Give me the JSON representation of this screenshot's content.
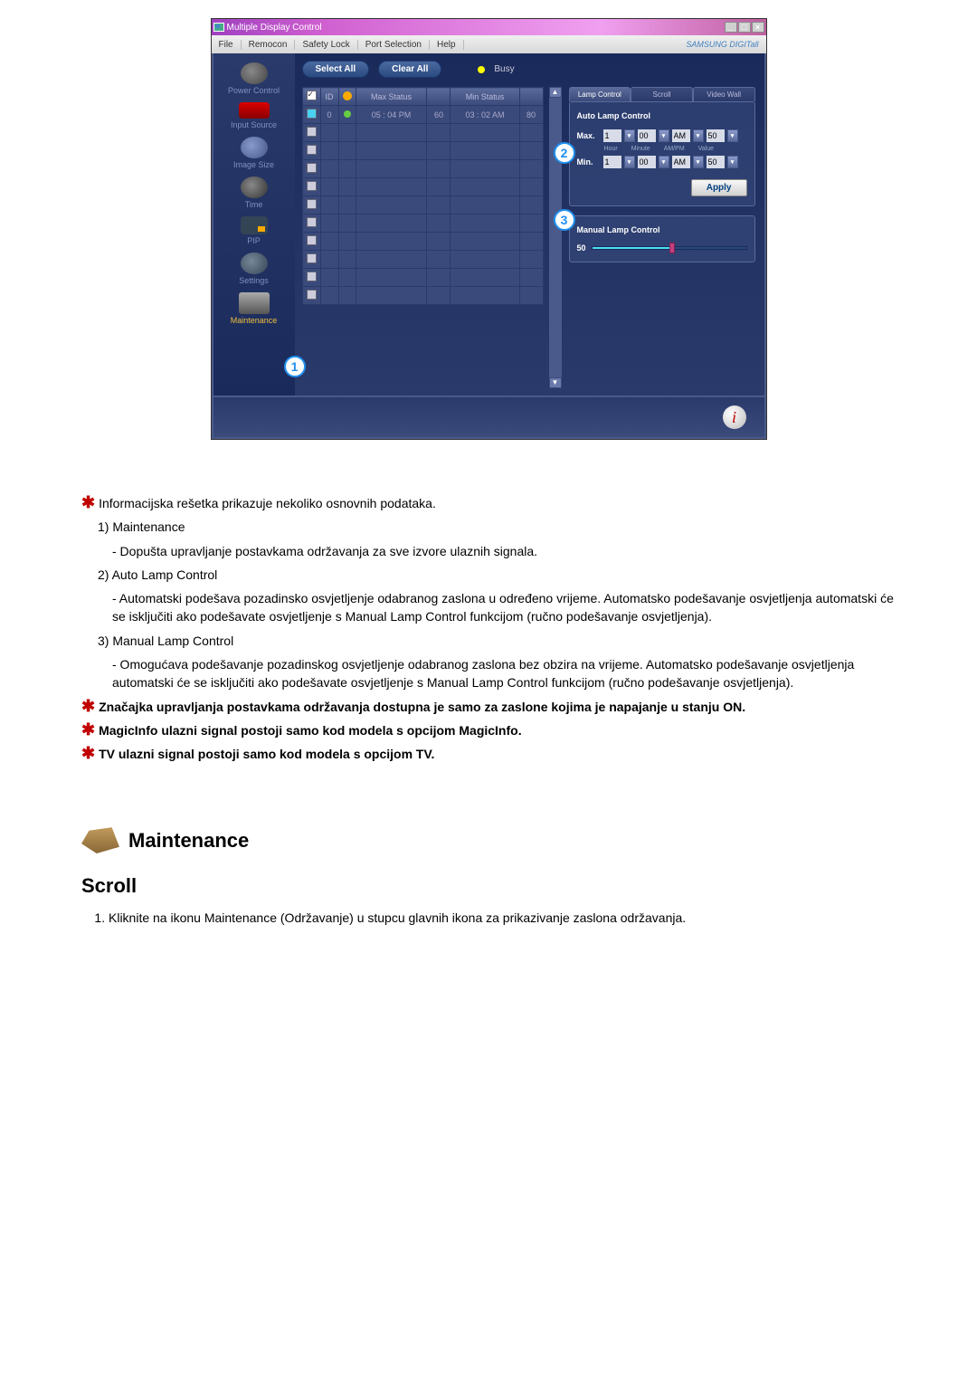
{
  "titlebar": {
    "title": "Multiple Display Control"
  },
  "menu": {
    "file": "File",
    "remocon": "Remocon",
    "safety": "Safety Lock",
    "port": "Port Selection",
    "help": "Help",
    "brand": "SAMSUNG DIGITall"
  },
  "sidebar": {
    "items": [
      {
        "label": "Power Control"
      },
      {
        "label": "Input Source"
      },
      {
        "label": "Image Size"
      },
      {
        "label": "Time"
      },
      {
        "label": "PIP"
      },
      {
        "label": "Settings"
      },
      {
        "label": "Maintenance"
      }
    ]
  },
  "toolbar": {
    "select_all": "Select All",
    "clear_all": "Clear All",
    "busy": "Busy"
  },
  "gridheaders": {
    "id": "ID",
    "maxstatus": "Max Status",
    "minstatus": "Min Status"
  },
  "gridrow0": {
    "id": "0",
    "maxtime": "05 : 04 PM",
    "maxval": "60",
    "mintime": "03 : 02 AM",
    "minval": "80"
  },
  "tabs": {
    "lamp": "Lamp Control",
    "scroll": "Scroll",
    "videowall": "Video Wall"
  },
  "autolamp": {
    "legend": "Auto Lamp Control",
    "max_label": "Max.",
    "min_label": "Min.",
    "hour": "1",
    "minute": "00",
    "ampm": "AM",
    "value": "50",
    "lbl_hour": "Hour",
    "lbl_minute": "Minute",
    "lbl_ampm": "AM/PM",
    "lbl_value": "Value",
    "apply": "Apply"
  },
  "manuallamp": {
    "legend": "Manual Lamp Control",
    "value": "50"
  },
  "callouts": {
    "c1": "1",
    "c2": "2",
    "c3": "3"
  },
  "doc": {
    "intro": "Informacijska rešetka prikazuje nekoliko osnovnih podataka.",
    "item1_title": "1)  Maintenance",
    "item1_desc": "- Dopušta upravljanje postavkama održavanja za sve izvore ulaznih signala.",
    "item2_title": "2)  Auto Lamp Control",
    "item2_desc": "- Automatski podešava pozadinsko osvjetljenje odabranog zaslona u određeno vrijeme. Automatsko podešavanje osvjetljenja automatski će se isključiti ako podešavate osvjetljenje s Manual Lamp Control funkcijom (ručno podešavanje osvjetljenja).",
    "item3_title": "3)  Manual Lamp Control",
    "item3_desc": "- Omogućava podešavanje pozadinskog osvjetljenje odabranog zaslona bez obzira na vrijeme. Automatsko podešavanje osvjetljenja automatski će se isključiti ako podešavate osvjetljenje s Manual Lamp Control funkcijom (ručno podešavanje osvjetljenja).",
    "note1": "Značajka upravljanja postavkama održavanja dostupna je samo za zaslone kojima je napajanje u stanju ON.",
    "note2": "MagicInfo ulazni signal postoji samo kod modela s opcijom MagicInfo.",
    "note3": "TV ulazni signal postoji samo kod modela s opcijom TV.",
    "section_title": "Maintenance",
    "scroll_heading": "Scroll",
    "scroll_step1": "Kliknite na ikonu Maintenance (Održavanje) u stupcu glavnih ikona za prikazivanje zaslona održavanja."
  }
}
